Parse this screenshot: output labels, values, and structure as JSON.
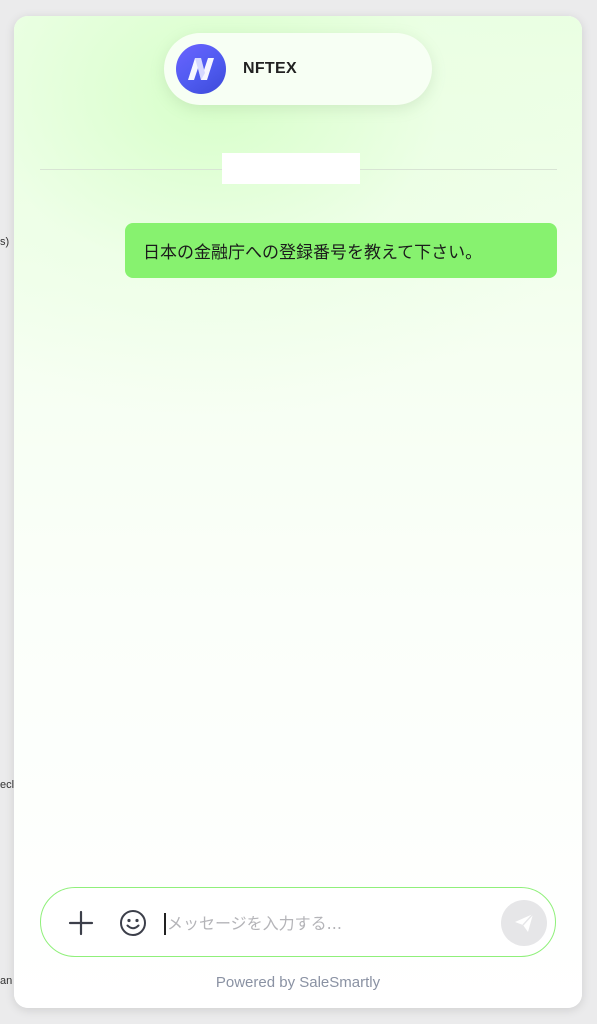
{
  "page_background_fragments": [
    "s)",
    "ecl",
    "an"
  ],
  "header": {
    "brand_name": "NFTEX",
    "avatar_icon": "nftex-logo-icon",
    "avatar_color": "#5a5ff5"
  },
  "conversation": {
    "date_label": "",
    "messages": [
      {
        "sender": "user",
        "text": "日本の金融庁への登録番号を教えて下さい。",
        "bubble_color": "#87f26f"
      }
    ]
  },
  "composer": {
    "attach_icon": "plus-icon",
    "emoji_icon": "smiley-icon",
    "placeholder": "メッセージを入力する...",
    "value": "",
    "send_icon": "paper-plane-icon",
    "border_color": "#8ff07a"
  },
  "footer": {
    "powered_by": "Powered by SaleSmartly"
  }
}
